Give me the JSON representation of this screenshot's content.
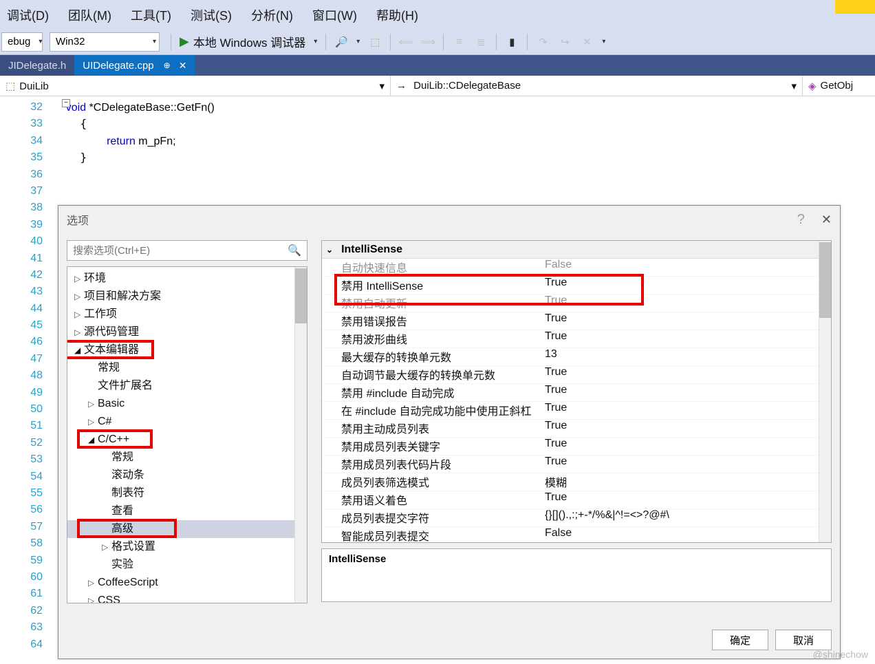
{
  "menu": [
    "调试(D)",
    "团队(M)",
    "工具(T)",
    "测试(S)",
    "分析(N)",
    "窗口(W)",
    "帮助(H)"
  ],
  "toolbar": {
    "config": "ebug",
    "platform": "Win32",
    "debugger": "本地 Windows 调试器"
  },
  "tabs": {
    "inactive": "JIDelegate.h",
    "active": "UIDelegate.cpp"
  },
  "nav": {
    "scope": "DuiLib",
    "class": "DuiLib::CDelegateBase",
    "member": "GetObj"
  },
  "code": {
    "line32": "void *CDelegateBase::GetFn()",
    "line33": "{",
    "line34_kw": "return",
    "line34_rest": " m_pFn;",
    "line35": "}"
  },
  "line_numbers": [
    "32",
    "33",
    "34",
    "35",
    "36",
    "37",
    "38",
    "39",
    "40",
    "41",
    "42",
    "43",
    "44",
    "45",
    "46",
    "47",
    "48",
    "49",
    "50",
    "51",
    "52",
    "53",
    "54",
    "55",
    "56",
    "57",
    "58",
    "59",
    "60",
    "61",
    "62",
    "63",
    "64"
  ],
  "dialog": {
    "title": "选项",
    "search_placeholder": "搜索选项(Ctrl+E)",
    "tree": [
      {
        "label": "环境",
        "exp": "▷",
        "ind": 0
      },
      {
        "label": "项目和解决方案",
        "exp": "▷",
        "ind": 0
      },
      {
        "label": "工作项",
        "exp": "▷",
        "ind": 0
      },
      {
        "label": "源代码管理",
        "exp": "▷",
        "ind": 0
      },
      {
        "label": "文本编辑器",
        "exp": "◢",
        "ind": 0,
        "hi": true
      },
      {
        "label": "常规",
        "exp": "",
        "ind": 1
      },
      {
        "label": "文件扩展名",
        "exp": "",
        "ind": 1
      },
      {
        "label": "Basic",
        "exp": "▷",
        "ind": 1
      },
      {
        "label": "C#",
        "exp": "▷",
        "ind": 1
      },
      {
        "label": "C/C++",
        "exp": "◢",
        "ind": 1,
        "hi": true
      },
      {
        "label": "常规",
        "exp": "",
        "ind": 2
      },
      {
        "label": "滚动条",
        "exp": "",
        "ind": 2
      },
      {
        "label": "制表符",
        "exp": "",
        "ind": 2
      },
      {
        "label": "查看",
        "exp": "",
        "ind": 2
      },
      {
        "label": "高级",
        "exp": "",
        "ind": 2,
        "sel": true,
        "hi": true
      },
      {
        "label": "格式设置",
        "exp": "▷",
        "ind": 2
      },
      {
        "label": "实验",
        "exp": "",
        "ind": 2
      },
      {
        "label": "CoffeeScript",
        "exp": "▷",
        "ind": 1
      },
      {
        "label": "CSS",
        "exp": "▷",
        "ind": 1
      }
    ],
    "grid_header": "IntelliSense",
    "grid": [
      {
        "k": "自动快速信息",
        "v": "False",
        "dim": true
      },
      {
        "k": "禁用 IntelliSense",
        "v": "True",
        "hi": true
      },
      {
        "k": "禁用自动更新",
        "v": "True",
        "dim": true
      },
      {
        "k": "禁用错误报告",
        "v": "True"
      },
      {
        "k": "禁用波形曲线",
        "v": "True"
      },
      {
        "k": "最大缓存的转换单元数",
        "v": "13"
      },
      {
        "k": "自动调节最大缓存的转换单元数",
        "v": "True"
      },
      {
        "k": "禁用 #include 自动完成",
        "v": "True"
      },
      {
        "k": "在 #include 自动完成功能中使用正斜杠",
        "v": "True"
      },
      {
        "k": "禁用主动成员列表",
        "v": "True"
      },
      {
        "k": "禁用成员列表关键字",
        "v": "True"
      },
      {
        "k": "禁用成员列表代码片段",
        "v": "True"
      },
      {
        "k": "成员列表筛选模式",
        "v": "模糊"
      },
      {
        "k": "禁用语义着色",
        "v": "True"
      },
      {
        "k": "成员列表提交字符",
        "v": "{}[]().,:;+-*/%&|^!=<>?@#\\"
      },
      {
        "k": "智能成员列表提交",
        "v": "False"
      }
    ],
    "desc_header": "IntelliSense",
    "ok": "确定",
    "cancel": "取消"
  },
  "watermark": "@shinechow"
}
